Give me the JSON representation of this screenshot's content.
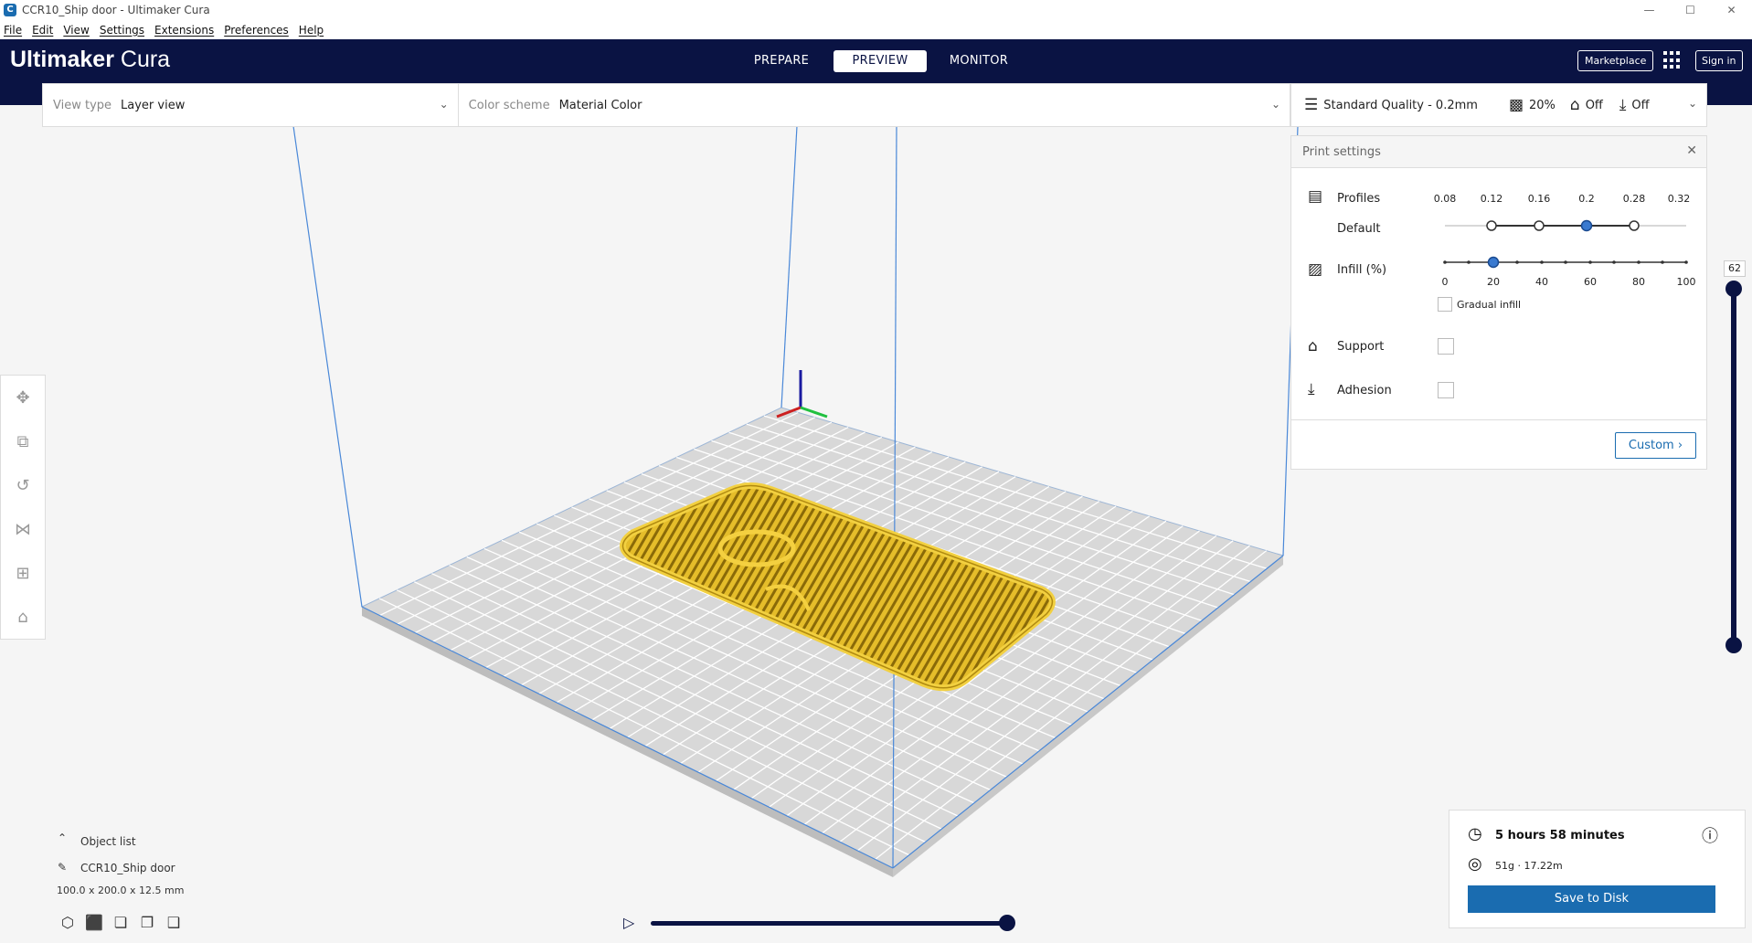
{
  "window": {
    "title": "CCR10_Ship door - Ultimaker Cura",
    "controls": [
      "—",
      "☐",
      "✕"
    ]
  },
  "menu": [
    "File",
    "Edit",
    "View",
    "Settings",
    "Extensions",
    "Preferences",
    "Help"
  ],
  "header": {
    "logo_main": "Ultimaker",
    "logo_sub": " Cura",
    "tabs": [
      {
        "label": "PREPARE",
        "active": false
      },
      {
        "label": "PREVIEW",
        "active": true
      },
      {
        "label": "MONITOR",
        "active": false
      }
    ],
    "marketplace": "Marketplace",
    "signin": "Sign in"
  },
  "view_bar": {
    "view_type_label": "View type",
    "view_type_value": "Layer view",
    "color_scheme_label": "Color scheme",
    "color_scheme_value": "Material Color"
  },
  "print_setup": {
    "quality": "Standard Quality - 0.2mm",
    "infill": "20%",
    "support": "Off",
    "adhesion": "Off"
  },
  "print_panel": {
    "title": "Print settings",
    "profiles_label": "Profiles",
    "profile_name": "Default",
    "layer_heights": [
      "0.08",
      "0.12",
      "0.16",
      "0.2",
      "0.28",
      "0.32"
    ],
    "selected_layer_height": "0.2",
    "infill_label": "Infill (%)",
    "infill_ticks": [
      "0",
      "20",
      "40",
      "60",
      "80",
      "100"
    ],
    "infill_value": 20,
    "gradual_infill": "Gradual infill",
    "support_label": "Support",
    "adhesion_label": "Adhesion",
    "custom_button": "Custom"
  },
  "layer_slider": {
    "current_layer": "62"
  },
  "object_list": {
    "header": "Object list",
    "object_name": "CCR10_Ship door",
    "dimensions": "100.0 x 200.0 x 12.5 mm"
  },
  "output": {
    "time": "5 hours 58 minutes",
    "material": "51g · 17.22m",
    "save_button": "Save to Disk"
  },
  "colors": {
    "header_bg": "#0a1343",
    "accent": "#1a6cb0",
    "model": "#e8c020"
  },
  "icons": {
    "clock": "clock-icon",
    "spool": "spool-icon",
    "info": "info-icon",
    "play": "play-icon"
  }
}
